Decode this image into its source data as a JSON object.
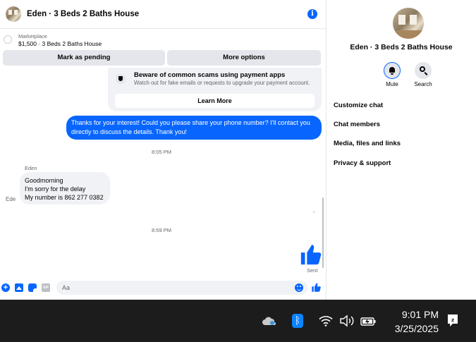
{
  "chat": {
    "title": "Eden · 3 Beds 2 Baths House",
    "marketplace_label": "Marketplace",
    "listing": "$1,500 · 3 Beds 2 Baths House",
    "buttons": {
      "pending": "Mark as pending",
      "more": "More options"
    },
    "scam_notice": {
      "title": "Beware of common scams using payment apps",
      "text": "Watch out for fake emails or requests to upgrade your payment account.",
      "learn_more": "Learn More"
    },
    "messages": [
      {
        "direction": "outgoing",
        "text": "Thanks for your interest! Could you please share your phone number? I'll contact you directly to discuss the details. Thank you!"
      },
      {
        "direction": "incoming",
        "sender": "Eden",
        "lines": [
          "Goodmorning",
          "I'm sorry for the delay",
          "My number is 862 277 0382"
        ]
      }
    ],
    "timestamps": [
      "8:05 PM",
      "8:59 PM"
    ],
    "side_sender_label": "Ede",
    "dash": "-",
    "sent_label": "Sent",
    "composer": {
      "placeholder": "Aa",
      "gif_label": "GIF"
    }
  },
  "details": {
    "title": "Eden · 3 Beds 2 Baths House",
    "actions": [
      {
        "label": "Mute",
        "icon": "bell-icon"
      },
      {
        "label": "Search",
        "icon": "search-icon"
      }
    ],
    "menu": [
      "Customize chat",
      "Chat members",
      "Media, files and links",
      "Privacy & support"
    ]
  },
  "taskbar": {
    "time": "9:01 PM",
    "date": "3/25/2025",
    "bluetooth_glyph": "ᛒ",
    "icons": [
      "onedrive-cloud-icon",
      "bluetooth-icon",
      "wifi-icon",
      "volume-icon",
      "battery-icon",
      "notification-icon"
    ]
  },
  "colors": {
    "accent": "#0866ff",
    "bubble_in": "#f0f2f5",
    "taskbar": "#1c1c1c"
  }
}
